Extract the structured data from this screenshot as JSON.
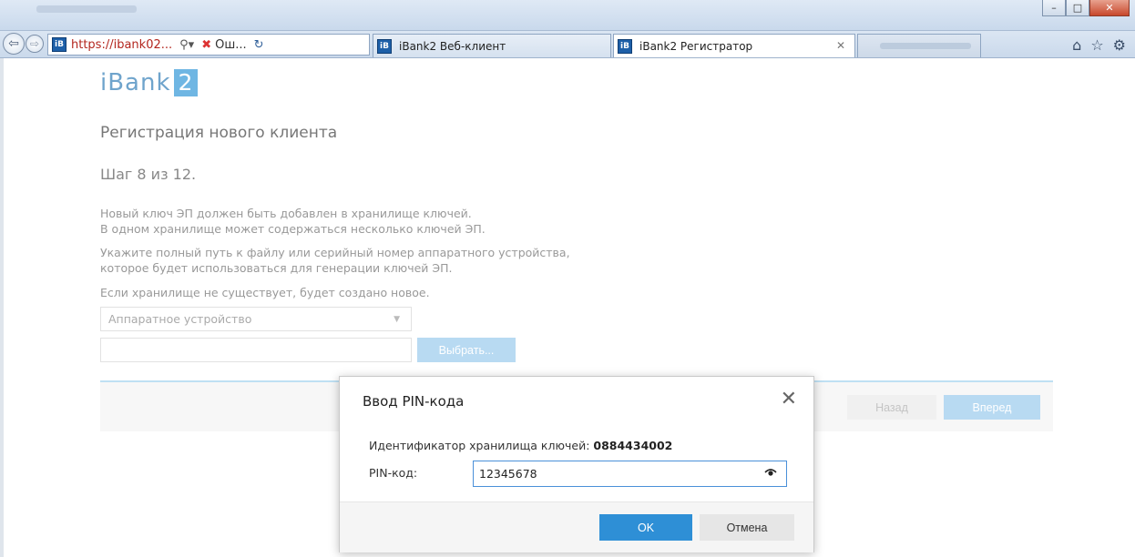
{
  "browser": {
    "address_url": "https://ibank02...",
    "tabs": [
      {
        "label": "Ош..."
      },
      {
        "label": "iBank2 Веб-клиент"
      },
      {
        "label": "iBank2 Регистратор"
      }
    ],
    "favicon_text": "iB",
    "accent": "#1d5fa8"
  },
  "page": {
    "logo_text": "iBank",
    "logo_badge": "2",
    "title": "Регистрация нового клиента",
    "step": "Шаг 8 из 12.",
    "paragraphs": {
      "p1_line1": "Новый ключ ЭП должен быть добавлен в хранилище ключей.",
      "p1_line2": "В одном хранилище может содержаться несколько ключей ЭП.",
      "p2_line1": "Укажите полный путь к файлу или серийный номер аппаратного устройства,",
      "p2_line2": "которое будет использоваться для генерации ключей ЭП.",
      "p3_line1": "Если хранилище не существует, будет создано новое."
    },
    "storage_type_selected": "Аппаратное устройство",
    "choose_button": "Выбрать...",
    "back_button": "Назад",
    "next_button": "Вперед"
  },
  "modal": {
    "title": "Ввод PIN-кода",
    "id_label": "Идентификатор хранилища ключей:",
    "id_value": "0884434002",
    "pin_label": "PIN-код:",
    "pin_value": "12345678",
    "ok_button": "OK",
    "cancel_button": "Отмена"
  },
  "colors": {
    "primary_button": "#2e8fd6",
    "disabled_button": "#b8daf2",
    "logo": "#6fa4cc"
  }
}
